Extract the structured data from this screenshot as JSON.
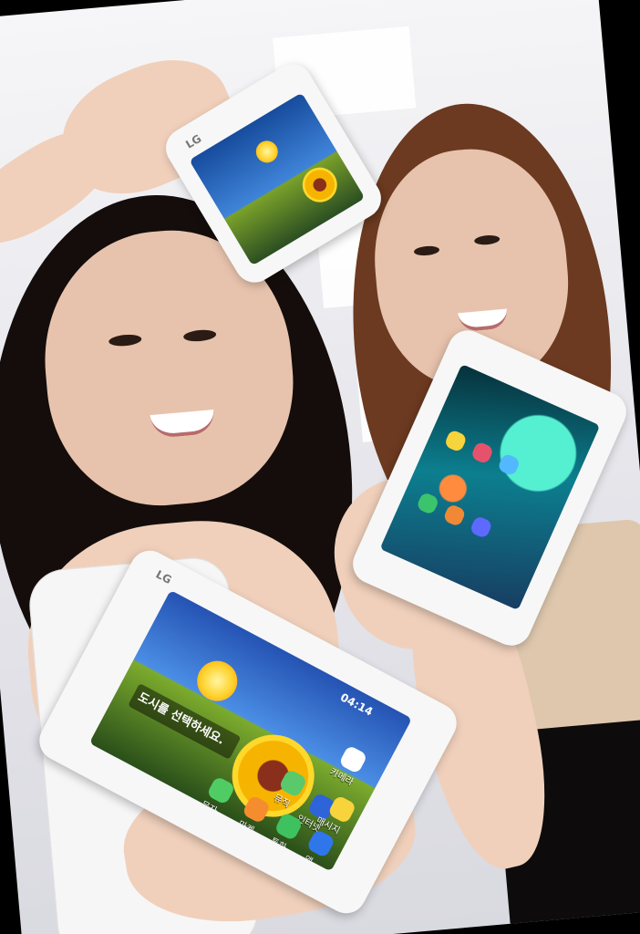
{
  "image": {
    "subjects": "Two women holding three white smartphones",
    "colors": {
      "background": "#e9e9ee",
      "hair": "#140d0b",
      "skin": "#e7c3ad",
      "phone_body": "#f7f7f7",
      "screen_sky": "#3e73d1",
      "flower": "#f6b400"
    }
  },
  "phones": {
    "front": {
      "brand": "LG",
      "time": "04:14",
      "city_prompt": "도시를 선택하세요.",
      "app_labels": [
        "카메라",
        "뮤직",
        "인터넷",
        "매시지",
        "문자",
        "마켓",
        "통화",
        "앱"
      ]
    },
    "top": {
      "brand": "LG"
    }
  }
}
